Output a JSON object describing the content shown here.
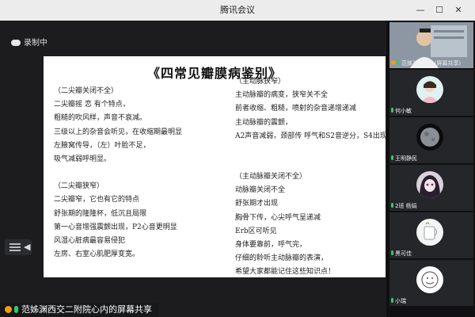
{
  "window": {
    "title": "腾讯会议",
    "min_icon": "minimize-icon",
    "max_icon": "maximize-icon",
    "close_icon": "close-icon"
  },
  "recording": {
    "label": "录制中",
    "icon": "cloud-icon"
  },
  "slide": {
    "title": "《四常见瓣膜病鉴别》",
    "left_column": [
      "（二尖瓣关闭不全）",
      "二尖瓣摇 恋 有个特点，",
      "粗糙的吹风样，声音不衰减。",
      "三级以上的杂音会听见，在收缩期最明显",
      "左腋窝传导，（左）叶脸不足，",
      "吸气减弱呼明显。",
      "",
      "（二尖瓣狭窄）",
      "二尖瓣窄，它也有它的特点",
      "舒张期的隆隆杯，低沉且局限",
      "第一心音增强震颤出现，P2心音更明显",
      "风湿心脏病最容易侵犯",
      "左房、右室心肌肥厚变宽。"
    ],
    "right_column": [
      "（主动脉狭窄）",
      "主动脉瓣的病变，狭窄关不全",
      "前者收缩、粗糙，喷射的杂音递增递减",
      "主动脉瓣的震颤，",
      "A2声音减弱，颈部传 呼气和S2音逆分，S4出现",
      "",
      "",
      "（主动脉瓣关闭不全）",
      "动脉瓣关闭不全",
      "舒张期才出现",
      "胸骨下传，心尖呼气呈递减",
      "Erb区可听见",
      "身体要靠前，呼气完，",
      "仔细的聆听主动脉瓣的表演，",
      "希望大家都能记住这些知识点！"
    ]
  },
  "sharer": {
    "label": "范姊渊西交二附院心内的屏幕共享"
  },
  "participants": [
    {
      "name": "范姊渊西交...(屏幕共享)",
      "avatar": "host-video"
    },
    {
      "name": "何小敏",
      "avatar": "photo-avatar"
    },
    {
      "name": "王明静民",
      "avatar": "planet-avatar"
    },
    {
      "name": "2班 杨娟",
      "avatar": "character-avatar"
    },
    {
      "name": "黑可佳",
      "avatar": "mug-avatar"
    },
    {
      "name": "小瑞",
      "avatar": "sketch-avatar"
    }
  ]
}
